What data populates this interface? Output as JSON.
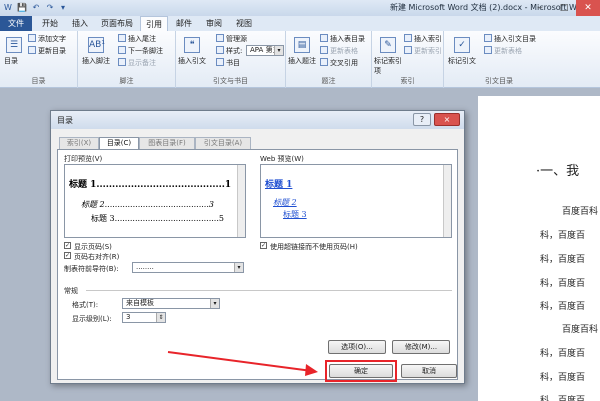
{
  "window": {
    "title": "新建 Microsoft Word 文档 (2).docx - Microsoft Word"
  },
  "quick_access": [
    "W",
    "💾",
    "↶",
    "↷",
    "▾"
  ],
  "tabs": [
    "文件",
    "开始",
    "插入",
    "页面布局",
    "引用",
    "邮件",
    "审阅",
    "视图"
  ],
  "ribbon": {
    "groups": {
      "toc": {
        "label": "目录",
        "big": "目录",
        "items": [
          "添加文字",
          "更新目录"
        ]
      },
      "footnote": {
        "label": "脚注",
        "big": "插入脚注",
        "items": [
          "插入尾注",
          "下一条脚注",
          "显示备注"
        ]
      },
      "citation": {
        "label": "引文与书目",
        "big": "插入引文",
        "items": [
          "管理源",
          "样式:",
          "APA 第五",
          "书目"
        ]
      },
      "caption": {
        "label": "题注",
        "big": "插入题注",
        "items": [
          "插入表目录",
          "更新表格",
          "交叉引用"
        ]
      },
      "index": {
        "label": "索引",
        "big": "标记索引项",
        "items": [
          "插入索引",
          "更新索引"
        ]
      },
      "authorities": {
        "label": "引文目录",
        "big": "标记引文",
        "items": [
          "插入引文目录",
          "更新表格"
        ]
      }
    }
  },
  "document": {
    "heading": "·一、我",
    "lines": [
      "百度百科",
      "科，百度百",
      "科，百度百",
      "科，百度百",
      "科，百度百",
      "百度百科",
      "科，百度百",
      "科，百度百",
      "科，百度百"
    ]
  },
  "dialog": {
    "title": "目录",
    "help": "?",
    "close": "×",
    "tabs": [
      "索引(X)",
      "目录(C)",
      "图表目录(F)",
      "引文目录(A)"
    ],
    "print_preview_label": "打印预览(V)",
    "print_preview": [
      {
        "text": "标题 1.........................................1"
      },
      {
        "text": "标题 2.........................................3"
      },
      {
        "text": "标题 3.........................................5"
      }
    ],
    "web_preview_label": "Web 预览(W)",
    "web_preview": [
      "标题 1",
      "标题 2",
      "标题 3"
    ],
    "show_page_numbers": "显示页码(S)",
    "right_align": "页码右对齐(R)",
    "tab_leader_label": "制表符前导符(B):",
    "tab_leader_value": "........",
    "use_hyperlinks": "使用超链接而不使用页码(H)",
    "general_label": "常规",
    "format_label": "格式(T):",
    "format_value": "来自模板",
    "levels_label": "显示级别(L):",
    "levels_value": "3",
    "options_button": "选项(O)...",
    "modify_button": "修改(M)...",
    "ok_button": "确定",
    "cancel_button": "取消"
  },
  "colors": {
    "accent": "#2b5797",
    "annotation": "#e8242a",
    "link": "#1f4fd1"
  }
}
